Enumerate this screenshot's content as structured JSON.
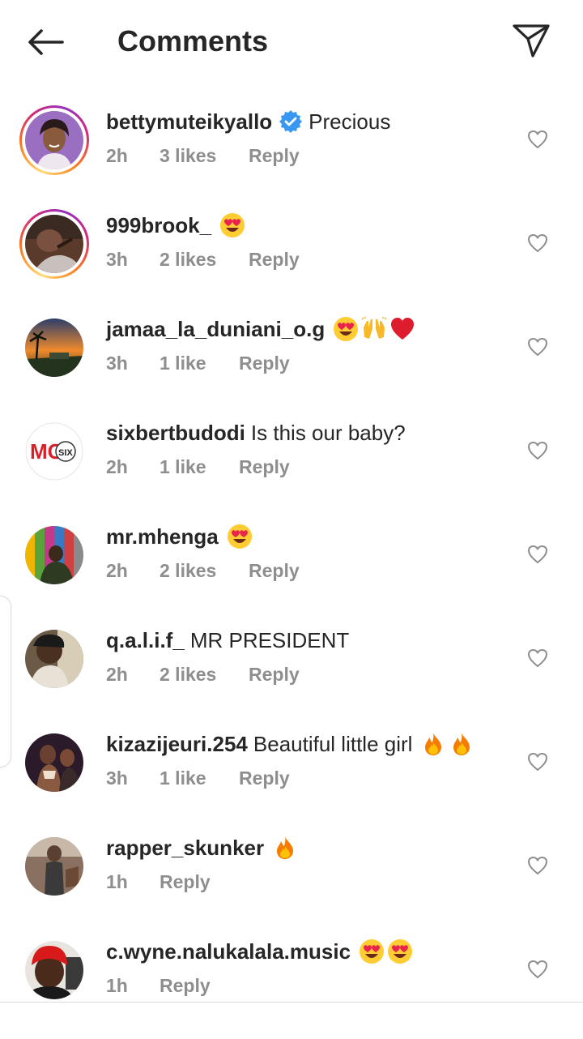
{
  "header": {
    "title": "Comments",
    "back_icon": "arrow-left-icon",
    "send_icon": "paper-plane-icon"
  },
  "colors": {
    "text_primary": "#262626",
    "text_secondary": "#8e8e8e",
    "verified_blue": "#3897f0",
    "fire": "#ff6a00"
  },
  "comments": [
    {
      "username": "bettymuteikyallo",
      "verified": true,
      "text": "Precious",
      "emojis": [],
      "time": "2h",
      "likes": "3 likes",
      "reply": "Reply",
      "story_ring": true
    },
    {
      "username": "999brook_",
      "verified": false,
      "text": "",
      "emojis": [
        "heart-eyes"
      ],
      "time": "3h",
      "likes": "2 likes",
      "reply": "Reply",
      "story_ring": true
    },
    {
      "username": "jamaa_la_duniani_o.g",
      "verified": false,
      "text": "",
      "emojis": [
        "heart-eyes",
        "raised-hands",
        "red-heart"
      ],
      "time": "3h",
      "likes": "1 like",
      "reply": "Reply",
      "story_ring": false
    },
    {
      "username": "sixbertbudodi",
      "verified": false,
      "text": "Is this our baby?",
      "emojis": [],
      "time": "2h",
      "likes": "1 like",
      "reply": "Reply",
      "story_ring": false,
      "avatar_text": "MC",
      "avatar_text2": "SIX"
    },
    {
      "username": "mr.mhenga",
      "verified": false,
      "text": "",
      "emojis": [
        "heart-eyes"
      ],
      "time": "2h",
      "likes": "2 likes",
      "reply": "Reply",
      "story_ring": false
    },
    {
      "username": "q.a.l.i.f_",
      "verified": false,
      "text": "MR PRESIDENT",
      "emojis": [],
      "time": "2h",
      "likes": "2 likes",
      "reply": "Reply",
      "story_ring": false
    },
    {
      "username": "kizazijeuri.254",
      "verified": false,
      "text": "Beautiful little girl",
      "emojis": [
        "fire",
        "fire"
      ],
      "time": "3h",
      "likes": "1 like",
      "reply": "Reply",
      "story_ring": false
    },
    {
      "username": "rapper_skunker",
      "verified": false,
      "text": "",
      "emojis": [
        "fire"
      ],
      "time": "1h",
      "likes": "",
      "reply": "Reply",
      "story_ring": false
    },
    {
      "username": "c.wyne.nalukalala.music",
      "verified": false,
      "text": "",
      "emojis": [
        "heart-eyes",
        "heart-eyes"
      ],
      "time": "1h",
      "likes": "",
      "reply": "Reply",
      "story_ring": false
    }
  ]
}
